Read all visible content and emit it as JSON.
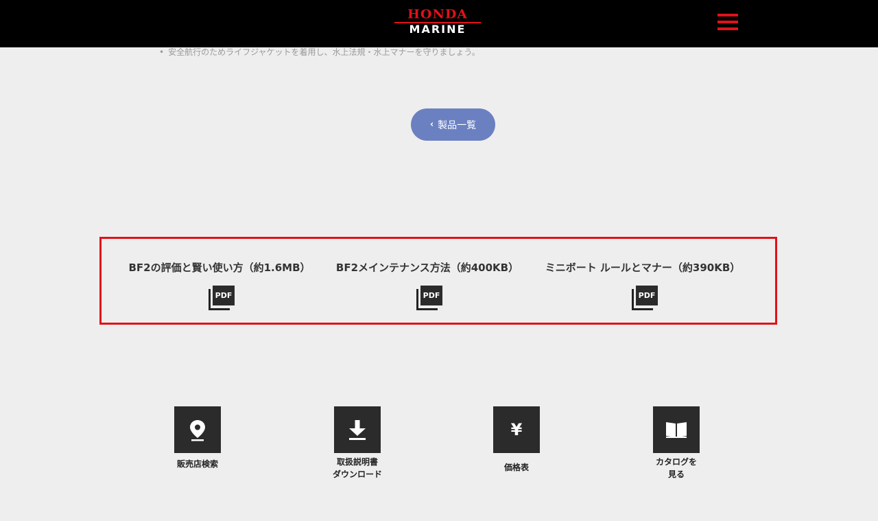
{
  "header": {
    "logo_top": "HONDA",
    "logo_bottom": "MARINE",
    "menu_icon": "hamburger-icon"
  },
  "note": {
    "text": "安全航行のためライフジャケットを着用し、水上法規・水上マナーを守りましょう。"
  },
  "back_button": {
    "label": "製品一覧",
    "icon": "chevron-left-icon"
  },
  "pdf_links": [
    {
      "title": "BF2の評価と賢い使い方（約1.6MB）",
      "icon_text": "PDF"
    },
    {
      "title": "BF2メインテナンス方法（約400KB）",
      "icon_text": "PDF"
    },
    {
      "title": "ミニボート ルールとマナー（約390KB）",
      "icon_text": "PDF"
    }
  ],
  "tiles": [
    {
      "line1": "販売店検索",
      "line2": "",
      "icon": "map-pin-icon"
    },
    {
      "line1": "取扱説明書",
      "line2": "ダウンロード",
      "icon": "download-icon"
    },
    {
      "line1": "価格表",
      "line2": "",
      "icon": "yen-icon",
      "symbol": "¥"
    },
    {
      "line1": "カタログを",
      "line2": "見る",
      "icon": "book-icon"
    }
  ],
  "colors": {
    "brand_red": "#e0121a",
    "button_blue": "#6b80c1",
    "tile_dark": "#2b2b2b",
    "background": "#efeeee"
  }
}
